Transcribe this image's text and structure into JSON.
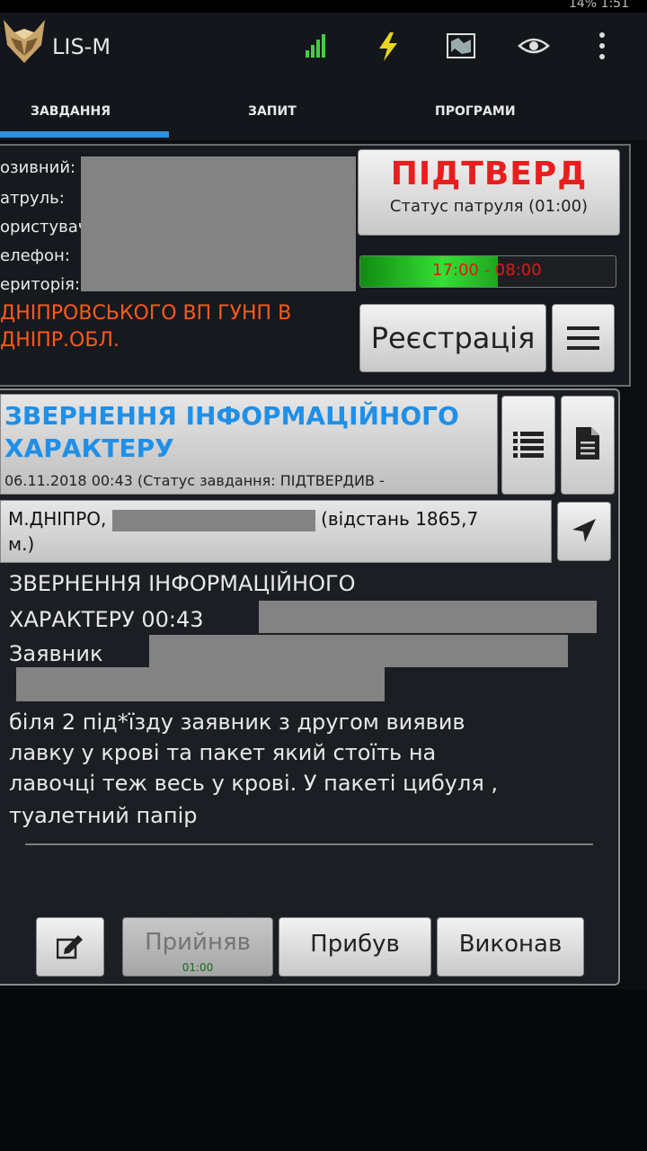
{
  "app": {
    "title": "LIS-M",
    "status_text": "14%  1:51"
  },
  "tabs": [
    {
      "label": "ЗАВДАННЯ",
      "active": true
    },
    {
      "label": "ЗАПИТ",
      "active": false
    },
    {
      "label": "ПРОГРАМИ",
      "active": false
    }
  ],
  "info": {
    "labels": [
      "озивний:",
      "атруль:",
      "ористувач",
      "елефон:",
      "ериторія:"
    ],
    "department": [
      "ДНІПРОВСЬКОГО ВП ГУНП В",
      "ДНІПР.ОБЛ."
    ]
  },
  "status_button": {
    "label": "ПІДТВЕРД",
    "sub": "Статус патруля (01:00)",
    "color": "#e81e1e"
  },
  "shift": {
    "text": "17:00 - 08:00",
    "fill_fraction": 0.54
  },
  "registration_button": {
    "label": "Реєстрація"
  },
  "task": {
    "title": "ЗВЕРНЕННЯ ІНФОРМАЦІЙНОГО ХАРАКТЕРУ",
    "date_status": "06.11.2018 00:43 (Статус завдання: ПІДТВЕРДИВ -",
    "address_prefix": "М.ДНІПРО,",
    "distance_line1": "(відстань 1865,7",
    "distance_line2": "м.)",
    "description_line1": "ЗВЕРНЕННЯ ІНФОРМАЦІЙНОГО",
    "description_line2": "ХАРАКТЕРУ 00:43",
    "applicant_label": "Заявник",
    "body_lines": [
      "біля 2 під*їзду заявник з другом виявив",
      "лавку у крові та пакет який стоїть на",
      "лавочці теж весь у крові. У пакеті цибуля ,",
      "туалетний папір"
    ],
    "title_color": "#1f8fe8"
  },
  "actions": {
    "accepted": {
      "label": "Прийняв",
      "time": "01:00"
    },
    "arrived": {
      "label": "Прибув"
    },
    "done": {
      "label": "Виконав"
    }
  },
  "icons": {
    "signal": "signal-bars-icon",
    "charge": "lightning-icon",
    "map": "map-icon",
    "eye": "eye-icon",
    "overflow": "overflow-menu-icon"
  }
}
